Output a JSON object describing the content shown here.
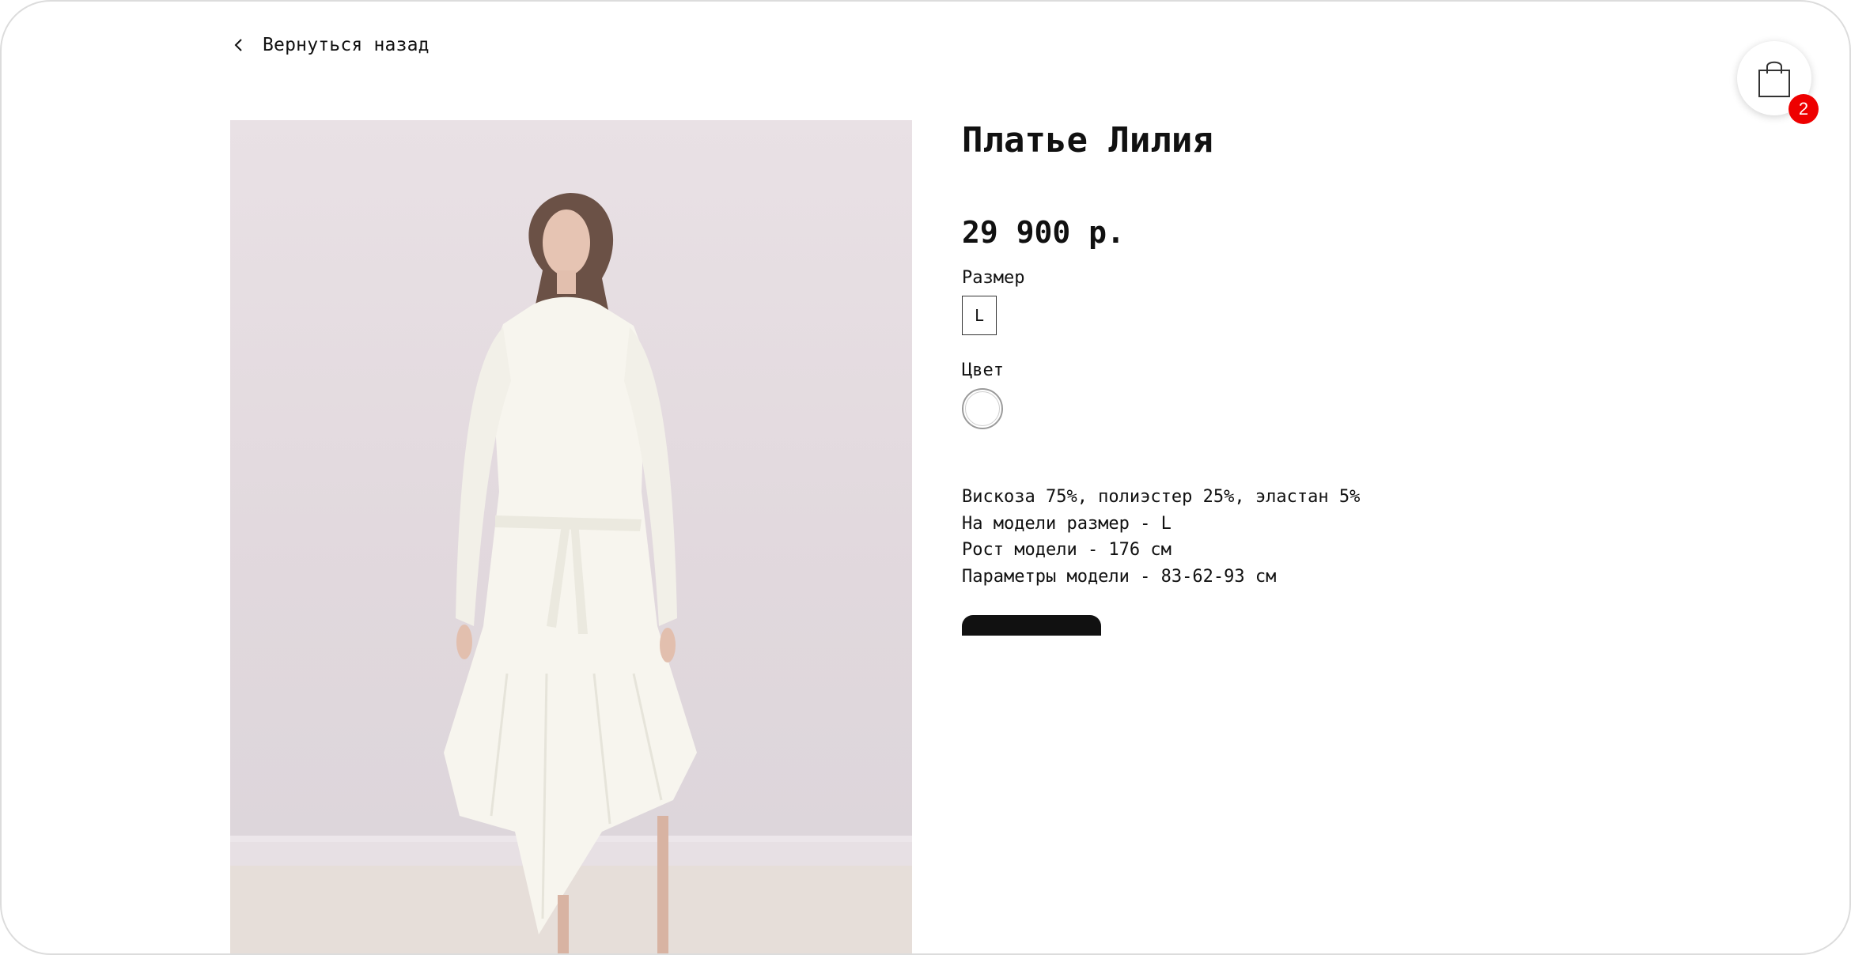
{
  "nav": {
    "back_label": "Вернуться назад",
    "back_icon": "chevron-left-icon"
  },
  "product": {
    "title": "Платье Лилия",
    "price": "29 900 р.",
    "size_label": "Размер",
    "sizes": [
      "L"
    ],
    "selected_size": "L",
    "color_label": "Цвет",
    "colors": [
      "#ffffff"
    ],
    "description": [
      "Вискоза 75%, полиэстер 25%, эластан 5%",
      "На модели размер - L",
      "Рост модели - 176 см",
      "Параметры модели - 83-62-93 см"
    ],
    "image_alt": "Model in white long-sleeve dress"
  },
  "cart": {
    "icon": "shopping-bag-icon",
    "count": "2",
    "badge_color": "#ee0000"
  },
  "colors": {
    "text": "#111111",
    "button": "#111111",
    "frame_border": "#dcdcdc"
  }
}
